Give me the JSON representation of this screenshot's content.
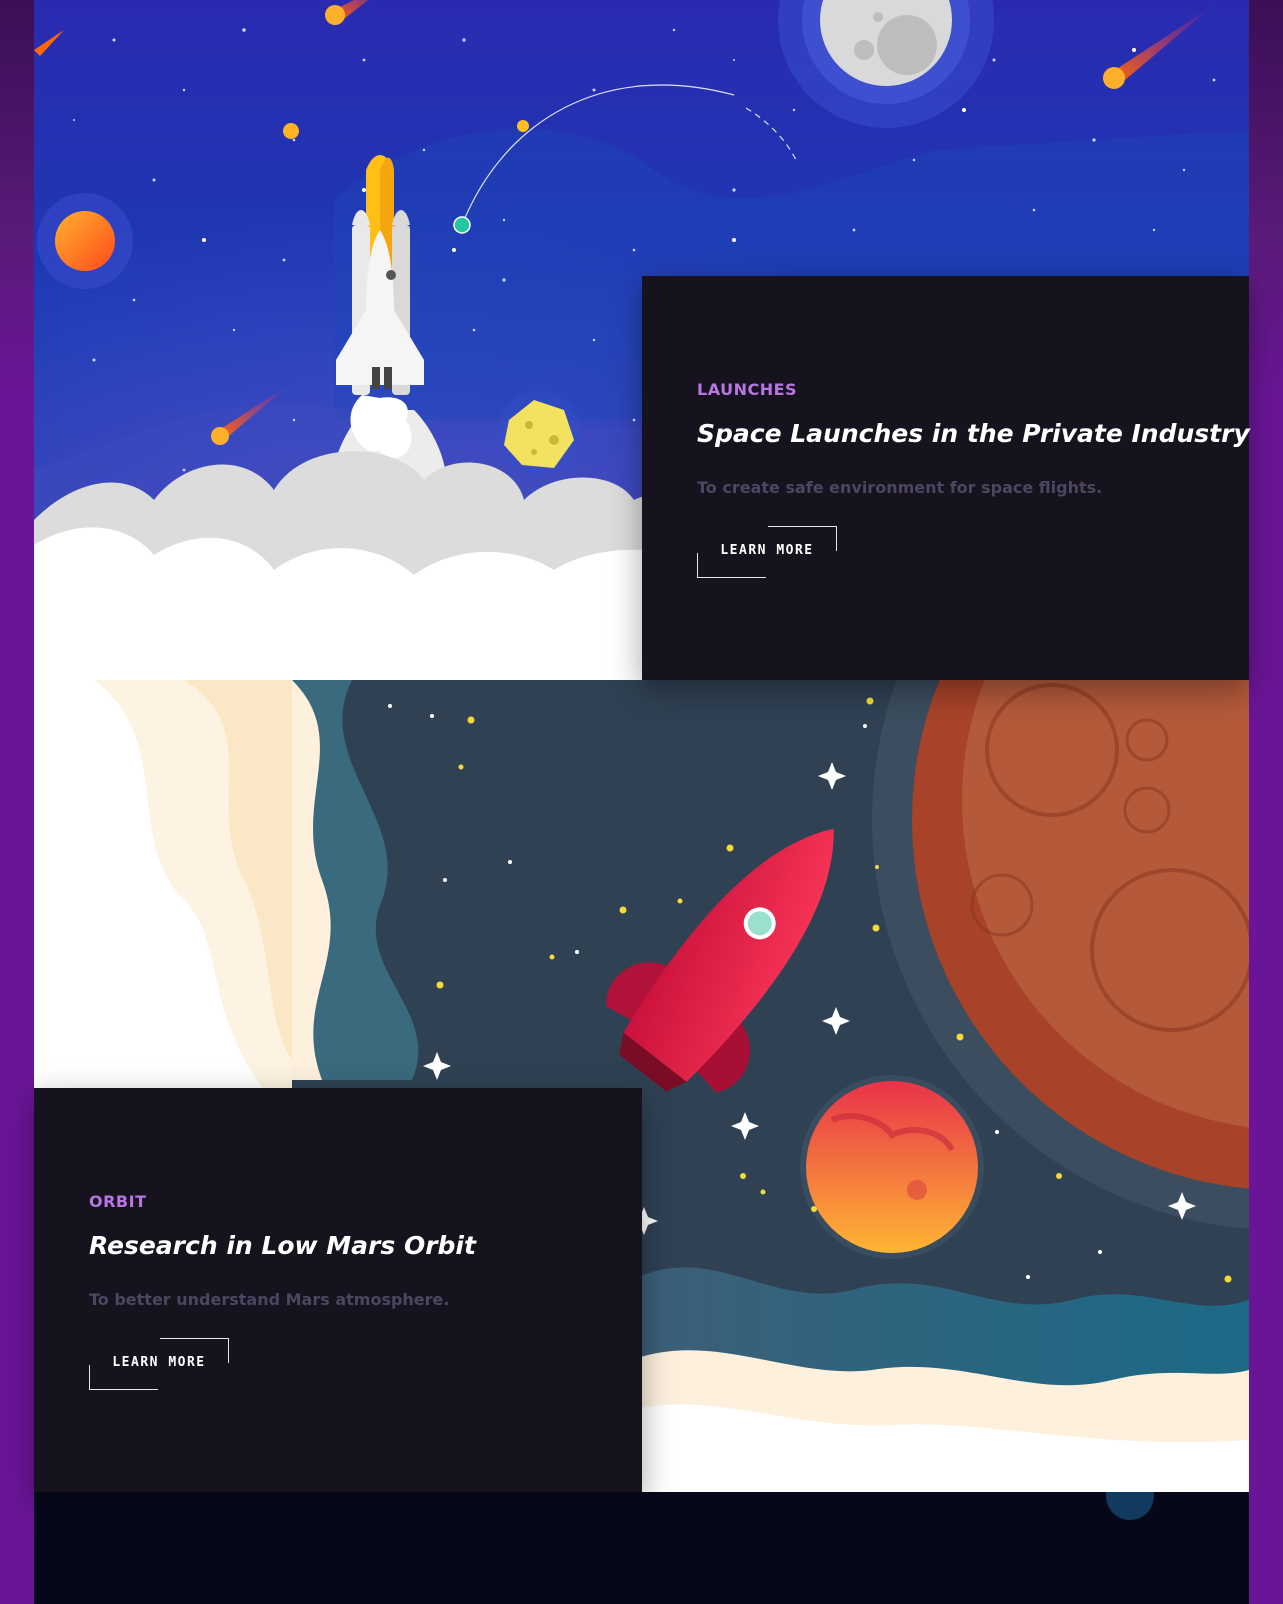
{
  "colors": {
    "frame_purple": "#6a1597",
    "space_blue": "#1436a0",
    "card_bg": "#16121e",
    "eyebrow": "#b777e0",
    "desc": "#4c4660",
    "footer": "#07071a"
  },
  "illustrations": {
    "hero": [
      "space-shuttle-icon",
      "moon-icon",
      "comet-icon",
      "orange-planet-icon",
      "asteroid-icon",
      "launch-smoke-cloud"
    ],
    "mars": [
      "red-rocket-icon",
      "mars-planet-icon",
      "small-red-planet-icon",
      "star-icon",
      "teal-wave",
      "cream-cloud"
    ]
  },
  "cards": [
    {
      "eyebrow": "LAUNCHES",
      "title": "Space Launches in the Private Industry",
      "description": "To create safe environment for space flights.",
      "button": "LEARN MORE"
    },
    {
      "eyebrow": "ORBIT",
      "title": "Research in Low Mars Orbit",
      "description": "To better understand Mars atmosphere.",
      "button": "LEARN MORE"
    }
  ]
}
